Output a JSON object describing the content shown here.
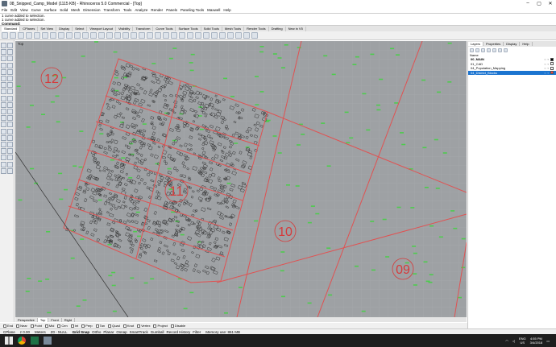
{
  "window": {
    "title": "08_Snipped_Camp_Model (1115 KB) - Rhinoceros 5.0 Commercial - [Top]",
    "buttons": [
      "–",
      "▢",
      "✕"
    ]
  },
  "menu": [
    "File",
    "Edit",
    "View",
    "Curve",
    "Surface",
    "Solid",
    "Mesh",
    "Dimension",
    "Transform",
    "Tools",
    "Analyze",
    "Render",
    "Panels",
    "Paneling Tools",
    "Maxwell",
    "Help"
  ],
  "command_history": {
    "line1": "1 curve added to selection.",
    "line2": "1 curve added to selection.",
    "prompt": "Command:"
  },
  "toolbar_tabs": [
    "Standard",
    "CPlanes",
    "Set View",
    "Display",
    "Select",
    "Viewport Layout",
    "Visibility",
    "Transform",
    "Curve Tools",
    "Surface Tools",
    "Solid Tools",
    "Mesh Tools",
    "Render Tools",
    "Drafting",
    "New in V5"
  ],
  "active_toolbar_tab": "Standard",
  "viewport": {
    "label": "Top",
    "zone_labels": [
      "12",
      "11",
      "10",
      "09"
    ],
    "zone_color": "#d63a3a",
    "curve_color": "#e05252",
    "grid_bg": "#9ea1a4"
  },
  "view_tabs": [
    "Perspective",
    "Top",
    "Front",
    "Right"
  ],
  "active_view_tab": "Top",
  "osnaps": [
    "End",
    "Near",
    "Point",
    "Mid",
    "Cen",
    "Int",
    "Perp",
    "Tan",
    "Quad",
    "Knot",
    "Vertex",
    "Project",
    "Disable"
  ],
  "status": {
    "cplane": "CPlane",
    "coord": "z 0.00",
    "units": "Meters",
    "layer": "Z0 - NULL",
    "toggles": [
      "Grid Snap",
      "Ortho",
      "Planar",
      "Osnap",
      "SmartTrack",
      "Gumball",
      "Record History",
      "Filter"
    ],
    "memory": "Memory use: 861 MB"
  },
  "right_panel": {
    "tabs": [
      "Layers",
      "Properties",
      "Display",
      "Help"
    ],
    "active_tab": "Layers",
    "header": "Name",
    "layers": [
      {
        "name": "00_MAIN",
        "bold": true,
        "selected": false,
        "color": "#000000"
      },
      {
        "name": "01_CAD",
        "bold": false,
        "selected": false,
        "color": "#ffffff"
      },
      {
        "name": "04_Population_Mapping",
        "bold": false,
        "selected": false,
        "color": "#ffffff"
      },
      {
        "name": "04_District_Blocks",
        "bold": false,
        "selected": true,
        "color": "#ff4040"
      }
    ]
  },
  "taskbar": {
    "lang": "ENG",
    "region": "US",
    "time": "4:55 PM",
    "date": "3/4/2018"
  }
}
